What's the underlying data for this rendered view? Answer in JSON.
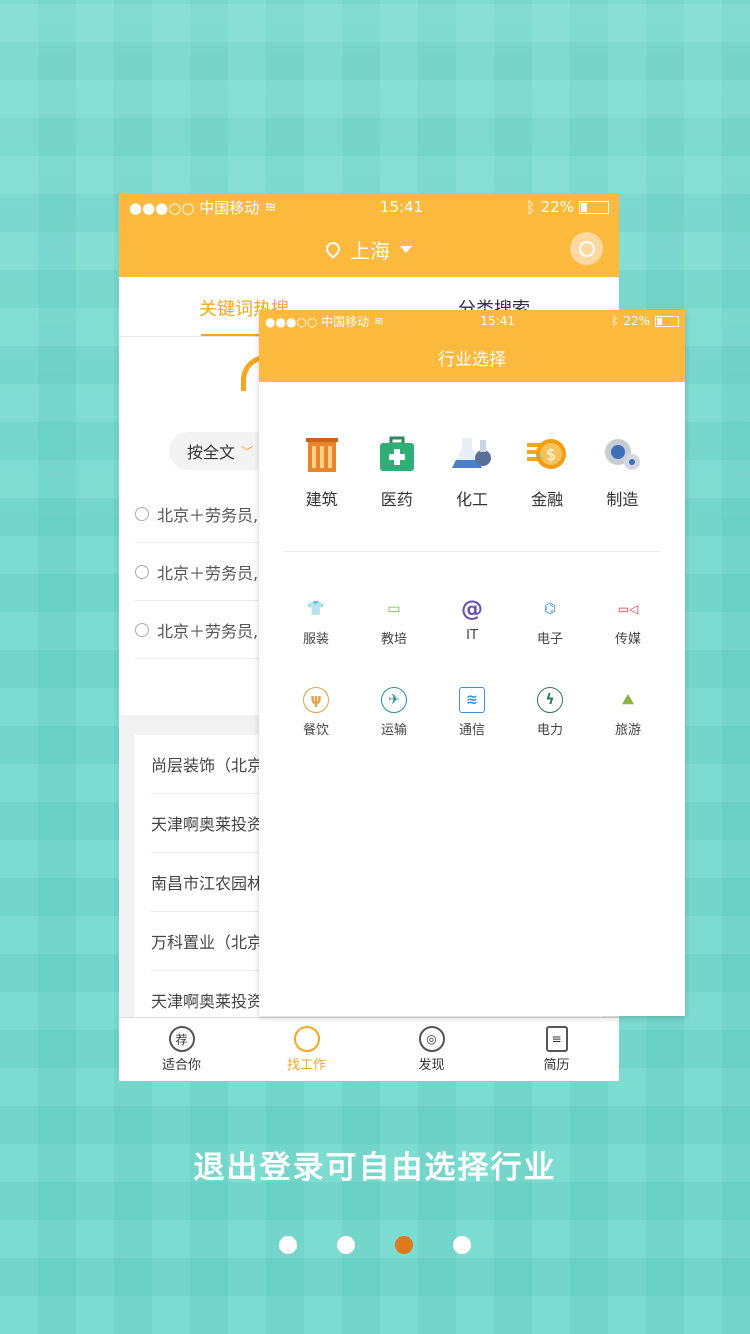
{
  "back": {
    "status": {
      "carrier": "●●●○○ 中国移动",
      "time": "15:41",
      "battery": "22%"
    },
    "city": "上海",
    "tabs": [
      "关键词热搜",
      "分类搜索"
    ],
    "search_mode": "按全文",
    "history": [
      "北京＋劳务员,",
      "北京＋劳务员,",
      "北京＋劳务员,"
    ],
    "companies": [
      "尚层装饰（北京",
      "天津啊奥莱投资",
      "南昌市江农园林",
      "万科置业（北京",
      "天津啊奥莱投资"
    ],
    "tabbar": [
      {
        "icon": "荐",
        "label": "适合你"
      },
      {
        "icon": "○",
        "label": "找工作"
      },
      {
        "icon": "◎",
        "label": "发现"
      },
      {
        "icon": "≡",
        "label": "简历"
      }
    ]
  },
  "front": {
    "status": {
      "carrier": "●●●○○ 中国移动",
      "time": "15:41",
      "battery": "22%"
    },
    "title": "行业选择",
    "major": [
      {
        "label": "建筑",
        "icon": "building-icon"
      },
      {
        "label": "医药",
        "icon": "medkit-icon"
      },
      {
        "label": "化工",
        "icon": "flask-icon"
      },
      {
        "label": "金融",
        "icon": "coin-icon"
      },
      {
        "label": "制造",
        "icon": "gear-icon"
      }
    ],
    "minor": [
      {
        "label": "服装",
        "glyph": "👕",
        "color": "#e05a8a"
      },
      {
        "label": "教培",
        "glyph": "▭",
        "color": "#7ab648"
      },
      {
        "label": "IT",
        "glyph": "@",
        "color": "#6a4fb3"
      },
      {
        "label": "电子",
        "glyph": "⌬",
        "color": "#3a8fd6"
      },
      {
        "label": "传媒",
        "glyph": "▭◁",
        "color": "#d9343a"
      },
      {
        "label": "餐饮",
        "glyph": "ψ",
        "color": "#e4a24a"
      },
      {
        "label": "运输",
        "glyph": "✈",
        "color": "#2b8fa3"
      },
      {
        "label": "通信",
        "glyph": "≋",
        "color": "#3a8fd6"
      },
      {
        "label": "电力",
        "glyph": "ϟ",
        "color": "#2b7a5e"
      },
      {
        "label": "旅游",
        "glyph": "⛰",
        "color": "#8ab43f"
      }
    ]
  },
  "caption": "退出登录可自由选择行业",
  "pager": {
    "count": 4,
    "active": 3
  }
}
